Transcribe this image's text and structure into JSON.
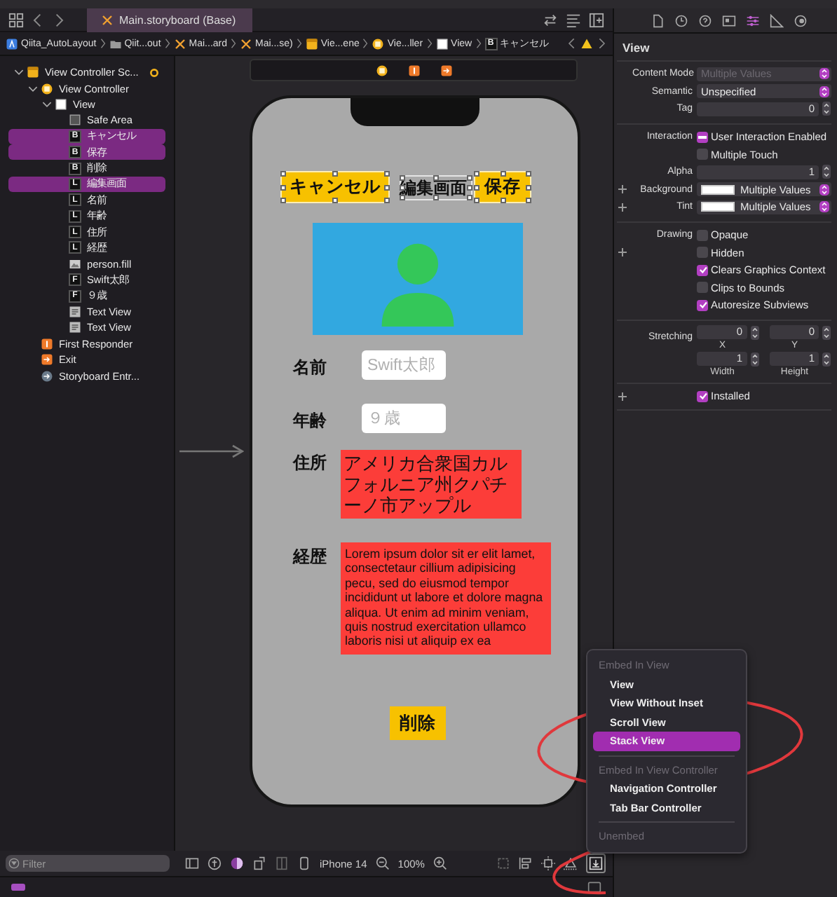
{
  "editor_tabs": [
    {
      "label": "Main.storyboard (Base)",
      "selected": true
    }
  ],
  "breadcrumb": [
    {
      "kind": "project",
      "label": "Qiita_AutoLayout"
    },
    {
      "kind": "folder",
      "label": "Qiit...out"
    },
    {
      "kind": "storyboard",
      "label": "Mai...ard"
    },
    {
      "kind": "storyboard",
      "label": "Mai...se)"
    },
    {
      "kind": "scene",
      "label": "Vie...ene"
    },
    {
      "kind": "controller",
      "label": "Vie...ller"
    },
    {
      "kind": "view",
      "label": "View"
    },
    {
      "kind": "letter",
      "badge": "B",
      "label": "キャンセル"
    }
  ],
  "navigator": {
    "items": [
      {
        "label": "View Controller Sc...",
        "kind": "scene",
        "marker": true,
        "expanded": true,
        "selected": false,
        "children": [
          {
            "label": "View Controller",
            "kind": "controller",
            "expanded": true,
            "selected": false,
            "children": [
              {
                "label": "View",
                "kind": "view",
                "expanded": true,
                "selected": false,
                "children": [
                  {
                    "label": "Safe Area",
                    "kind": "safe",
                    "selected": false
                  },
                  {
                    "label": "キャンセル",
                    "kind": "letter",
                    "badge": "B",
                    "selected": true
                  },
                  {
                    "label": "保存",
                    "kind": "letter",
                    "badge": "B",
                    "selected": true
                  },
                  {
                    "label": "削除",
                    "kind": "letter",
                    "badge": "B",
                    "selected": false
                  },
                  {
                    "label": "編集画面",
                    "kind": "letter",
                    "badge": "L",
                    "selected": true
                  },
                  {
                    "label": "名前",
                    "kind": "letter",
                    "badge": "L",
                    "selected": false
                  },
                  {
                    "label": "年齢",
                    "kind": "letter",
                    "badge": "L",
                    "selected": false
                  },
                  {
                    "label": "住所",
                    "kind": "letter",
                    "badge": "L",
                    "selected": false
                  },
                  {
                    "label": "経歴",
                    "kind": "letter",
                    "badge": "L",
                    "selected": false
                  },
                  {
                    "label": "person.fill",
                    "kind": "image",
                    "selected": false
                  },
                  {
                    "label": "Swift太郎",
                    "kind": "letter",
                    "badge": "F",
                    "selected": false
                  },
                  {
                    "label": "９歳",
                    "kind": "letter",
                    "badge": "F",
                    "selected": false
                  },
                  {
                    "label": "Text View",
                    "kind": "textview",
                    "selected": false
                  },
                  {
                    "label": "Text View",
                    "kind": "textview",
                    "selected": false
                  }
                ]
              }
            ]
          },
          {
            "label": "First Responder",
            "kind": "responder",
            "selected": false
          },
          {
            "label": "Exit",
            "kind": "exit",
            "selected": false
          },
          {
            "label": "Storyboard Entr...",
            "kind": "entry",
            "selected": false
          }
        ]
      }
    ]
  },
  "filter": {
    "placeholder": "Filter"
  },
  "canvas": {
    "elements": [
      {
        "kind": "button",
        "text": "キャンセル",
        "selected": true
      },
      {
        "kind": "label",
        "text": "編集画面",
        "selected": true
      },
      {
        "kind": "button",
        "text": "保存",
        "selected": true
      },
      {
        "kind": "image",
        "selected": false
      },
      {
        "kind": "label",
        "text": "名前",
        "selected": false
      },
      {
        "kind": "field",
        "placeholder": "Swift太郎",
        "selected": false
      },
      {
        "kind": "label",
        "text": "年齢",
        "selected": false
      },
      {
        "kind": "field",
        "placeholder": "９歳",
        "selected": false
      },
      {
        "kind": "label",
        "text": "住所",
        "selected": false
      },
      {
        "kind": "textview",
        "text": "アメリカ合衆国カルフォルニア州クパチーノ市アップル",
        "selected": false
      },
      {
        "kind": "label",
        "text": "経歴",
        "selected": false
      },
      {
        "kind": "textview",
        "text": "Lorem ipsum dolor sit er elit lamet, consectetaur cillium adipisicing pecu, sed do eiusmod tempor incididunt ut labore et dolore magna aliqua. Ut enim ad minim veniam, quis nostrud exercitation ullamco laboris nisi ut aliquip ex ea",
        "selected": false
      },
      {
        "kind": "button",
        "text": "削除",
        "selected": false
      }
    ],
    "device": "iPhone 14",
    "zoom": "100%"
  },
  "inspector": {
    "title": "View",
    "sections": [
      [
        {
          "kind": "select",
          "label": "Content Mode",
          "value": "Multiple Values",
          "disabled": true,
          "plus": false
        },
        {
          "kind": "select",
          "label": "Semantic",
          "value": "Unspecified",
          "disabled": false,
          "plus": false
        },
        {
          "kind": "number",
          "label": "Tag",
          "value": "0",
          "plus": false
        }
      ],
      [
        {
          "kind": "check",
          "label": "Interaction",
          "text": "User Interaction Enabled",
          "checked": true,
          "mixed": true,
          "plus": false
        },
        {
          "kind": "check",
          "text": "Multiple Touch",
          "checked": false,
          "mixed": false,
          "plus": false
        },
        {
          "kind": "number",
          "label": "Alpha",
          "value": "1",
          "plus": false
        },
        {
          "kind": "color",
          "label": "Background",
          "value": "Multiple Values",
          "plus": true
        },
        {
          "kind": "color",
          "label": "Tint",
          "value": "Multiple Values",
          "plus": true
        }
      ],
      [
        {
          "kind": "check",
          "label": "Drawing",
          "text": "Opaque",
          "checked": false,
          "mixed": false,
          "plus": false
        },
        {
          "kind": "check",
          "text": "Hidden",
          "checked": false,
          "mixed": false,
          "plus": true
        },
        {
          "kind": "check",
          "text": "Clears Graphics Context",
          "checked": true,
          "mixed": false,
          "plus": false
        },
        {
          "kind": "check",
          "text": "Clips to Bounds",
          "checked": false,
          "mixed": false,
          "plus": false
        },
        {
          "kind": "check",
          "text": "Autoresize Subviews",
          "checked": true,
          "mixed": false,
          "plus": false
        }
      ],
      [
        {
          "kind": "pair",
          "label": "Stretching",
          "fields": [
            {
              "value": "0",
              "caption": "X"
            },
            {
              "value": "0",
              "caption": "Y"
            }
          ],
          "plus": false
        },
        {
          "kind": "pair",
          "fields": [
            {
              "value": "1",
              "caption": "Width"
            },
            {
              "value": "1",
              "caption": "Height"
            }
          ],
          "plus": false
        }
      ],
      [
        {
          "kind": "check",
          "text": "Installed",
          "checked": true,
          "mixed": false,
          "plus": true
        }
      ]
    ]
  },
  "menu": {
    "items": [
      {
        "kind": "header",
        "text": "Embed In View"
      },
      {
        "kind": "item",
        "text": "View",
        "selected": false
      },
      {
        "kind": "item",
        "text": "View Without Inset",
        "selected": false
      },
      {
        "kind": "item",
        "text": "Scroll View",
        "selected": false
      },
      {
        "kind": "item",
        "text": "Stack View",
        "selected": true
      },
      {
        "kind": "separator"
      },
      {
        "kind": "header",
        "text": "Embed In View Controller"
      },
      {
        "kind": "item",
        "text": "Navigation Controller",
        "selected": false
      },
      {
        "kind": "item",
        "text": "Tab Bar Controller",
        "selected": false
      },
      {
        "kind": "separator"
      },
      {
        "kind": "header",
        "text": "Unembed"
      }
    ]
  },
  "annotations": [
    {
      "kind": "ellipse"
    },
    {
      "kind": "loop"
    }
  ]
}
